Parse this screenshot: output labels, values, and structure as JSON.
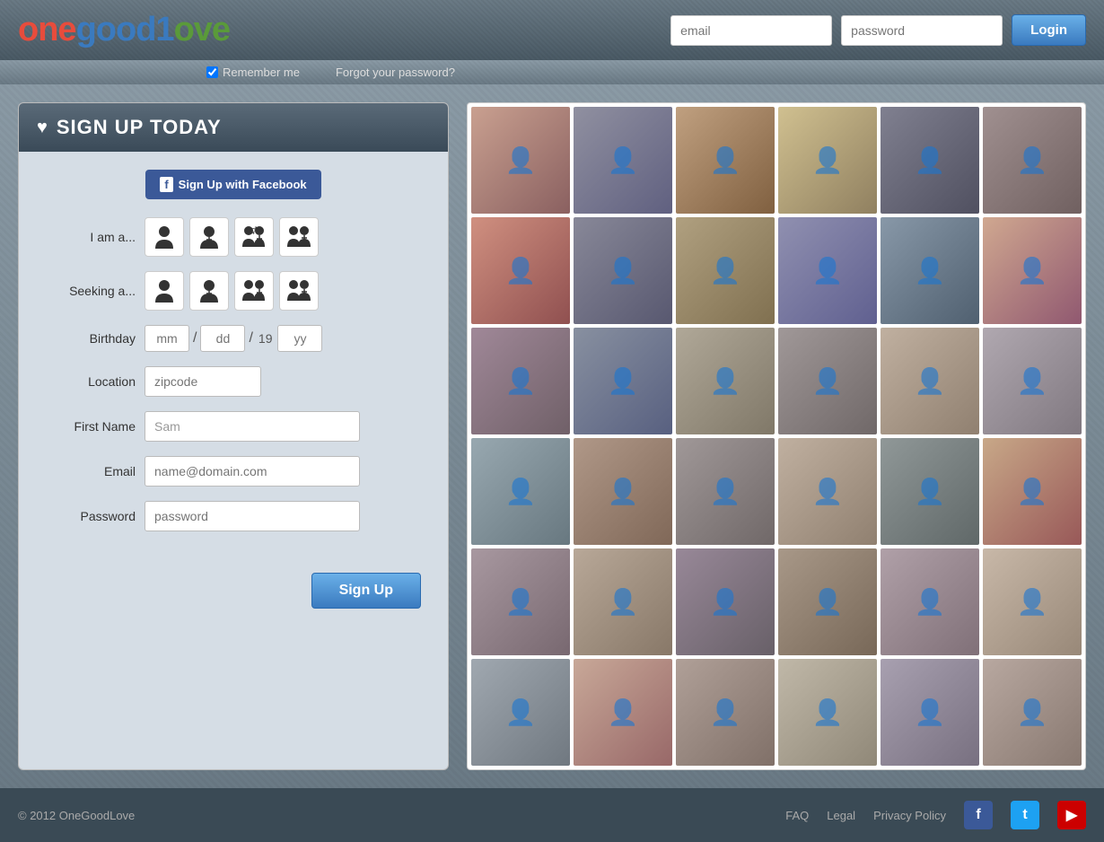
{
  "header": {
    "logo": {
      "one": "one",
      "good": "good",
      "one2": "1",
      "love": "ove"
    },
    "email_placeholder": "email",
    "password_placeholder": "password",
    "login_label": "Login",
    "remember_me": "Remember me",
    "forgot_password": "Forgot your password?"
  },
  "signup": {
    "title": "SIGN UP TODAY",
    "facebook_btn": "Sign Up with Facebook",
    "facebook_prefix": "f",
    "iam_label": "I am a...",
    "seeking_label": "Seeking a...",
    "birthday_label": "Birthday",
    "birthday_mm": "mm",
    "birthday_dd": "dd",
    "birthday_19": "19",
    "birthday_yy": "yy",
    "location_label": "Location",
    "location_placeholder": "zipcode",
    "firstname_label": "First Name",
    "firstname_value": "Sam",
    "email_label": "Email",
    "email_placeholder": "name@domain.com",
    "password_label": "Password",
    "password_placeholder": "password",
    "signup_btn": "Sign Up"
  },
  "footer": {
    "copyright": "© 2012 OneGoodLove",
    "faq": "FAQ",
    "legal": "Legal",
    "privacy": "Privacy Policy"
  },
  "gender_icons": {
    "man": "👤",
    "woman": "👤",
    "man_woman": "⚥",
    "couple": "⚥"
  }
}
